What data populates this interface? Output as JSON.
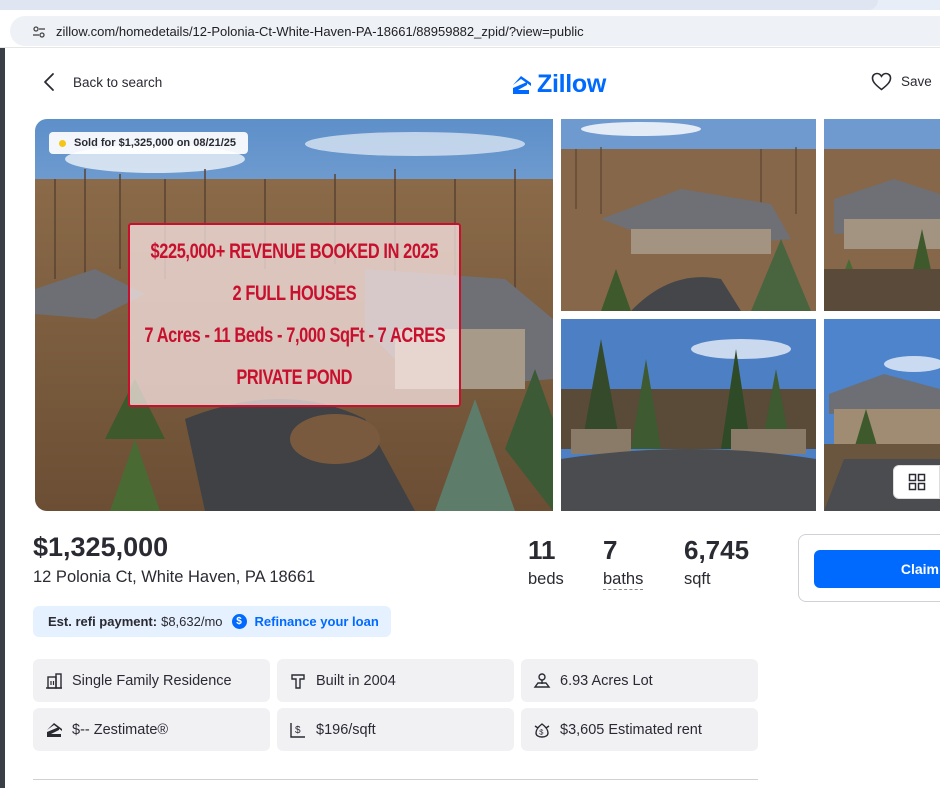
{
  "browser": {
    "url": "zillow.com/homedetails/12-Polonia-Ct-White-Haven-PA-18661/88959882_zpid/?view=public"
  },
  "nav": {
    "back_label": "Back to search",
    "logo_text": "Zillow",
    "save_label": "Save"
  },
  "gallery": {
    "sold_badge": "Sold for $1,325,000 on 08/21/25",
    "overlay_lines": [
      "$225,000+ REVENUE BOOKED IN 2025",
      "2 FULL HOUSES",
      "7 Acres - 11 Beds - 7,000 SqFt - 7 ACRES",
      "PRIVATE POND"
    ]
  },
  "summary": {
    "price": "$1,325,000",
    "address": "12 Polonia Ct, White Haven, PA 18661",
    "beds_value": "11",
    "beds_label": "beds",
    "baths_value": "7",
    "baths_label": "baths",
    "sqft_value": "6,745",
    "sqft_label": "sqft"
  },
  "claim": {
    "button_label": "Claim"
  },
  "refi": {
    "label": "Est. refi payment:",
    "value": "$8,632/mo",
    "icon_letter": "$",
    "link": "Refinance your loan"
  },
  "facts": [
    {
      "icon": "building-icon",
      "text": "Single Family Residence"
    },
    {
      "icon": "hammer-icon",
      "text": "Built in 2004"
    },
    {
      "icon": "lot-icon",
      "text": "6.93 Acres Lot"
    },
    {
      "icon": "zestimate-icon",
      "text": "$-- Zestimate®"
    },
    {
      "icon": "price-per-sqft-icon",
      "text": "$196/sqft"
    },
    {
      "icon": "rent-icon",
      "text": "$3,605 Estimated rent"
    }
  ],
  "colors": {
    "brand_blue": "#006aff",
    "overlay_red": "#c8102e",
    "sold_dot": "#f5c518"
  }
}
